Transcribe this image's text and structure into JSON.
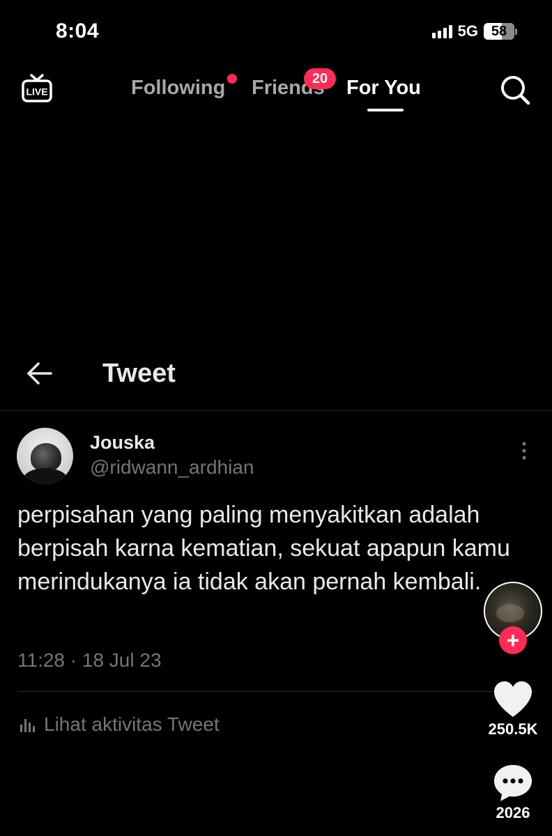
{
  "status_bar": {
    "time": "8:04",
    "network": "5G",
    "battery": "58"
  },
  "top_nav": {
    "live_label": "LIVE",
    "tabs": [
      {
        "label": "Following",
        "has_dot": true
      },
      {
        "label": "Friends",
        "badge": "20"
      },
      {
        "label": "For You",
        "active": true
      }
    ]
  },
  "tweet": {
    "header_title": "Tweet",
    "author_name": "Jouska",
    "author_handle": "@ridwann_ardhian",
    "text": "perpisahan yang paling menyakitkan adalah berpisah karna kematian, sekuat apapun kamu merindukanya ia tidak akan pernah kembali.",
    "timestamp": "11:28 · 18 Jul 23",
    "activity_label": "Lihat aktivitas Tweet"
  },
  "actions": {
    "follow_symbol": "+",
    "likes": "250.5K",
    "comments": "2026"
  },
  "colors": {
    "accent": "#fe2c55",
    "background": "#000000",
    "muted_text": "#71767b"
  },
  "icons": [
    "live-icon",
    "search-icon",
    "back-arrow-icon",
    "more-options-icon",
    "bar-chart-icon",
    "heart-icon",
    "comment-icon"
  ]
}
